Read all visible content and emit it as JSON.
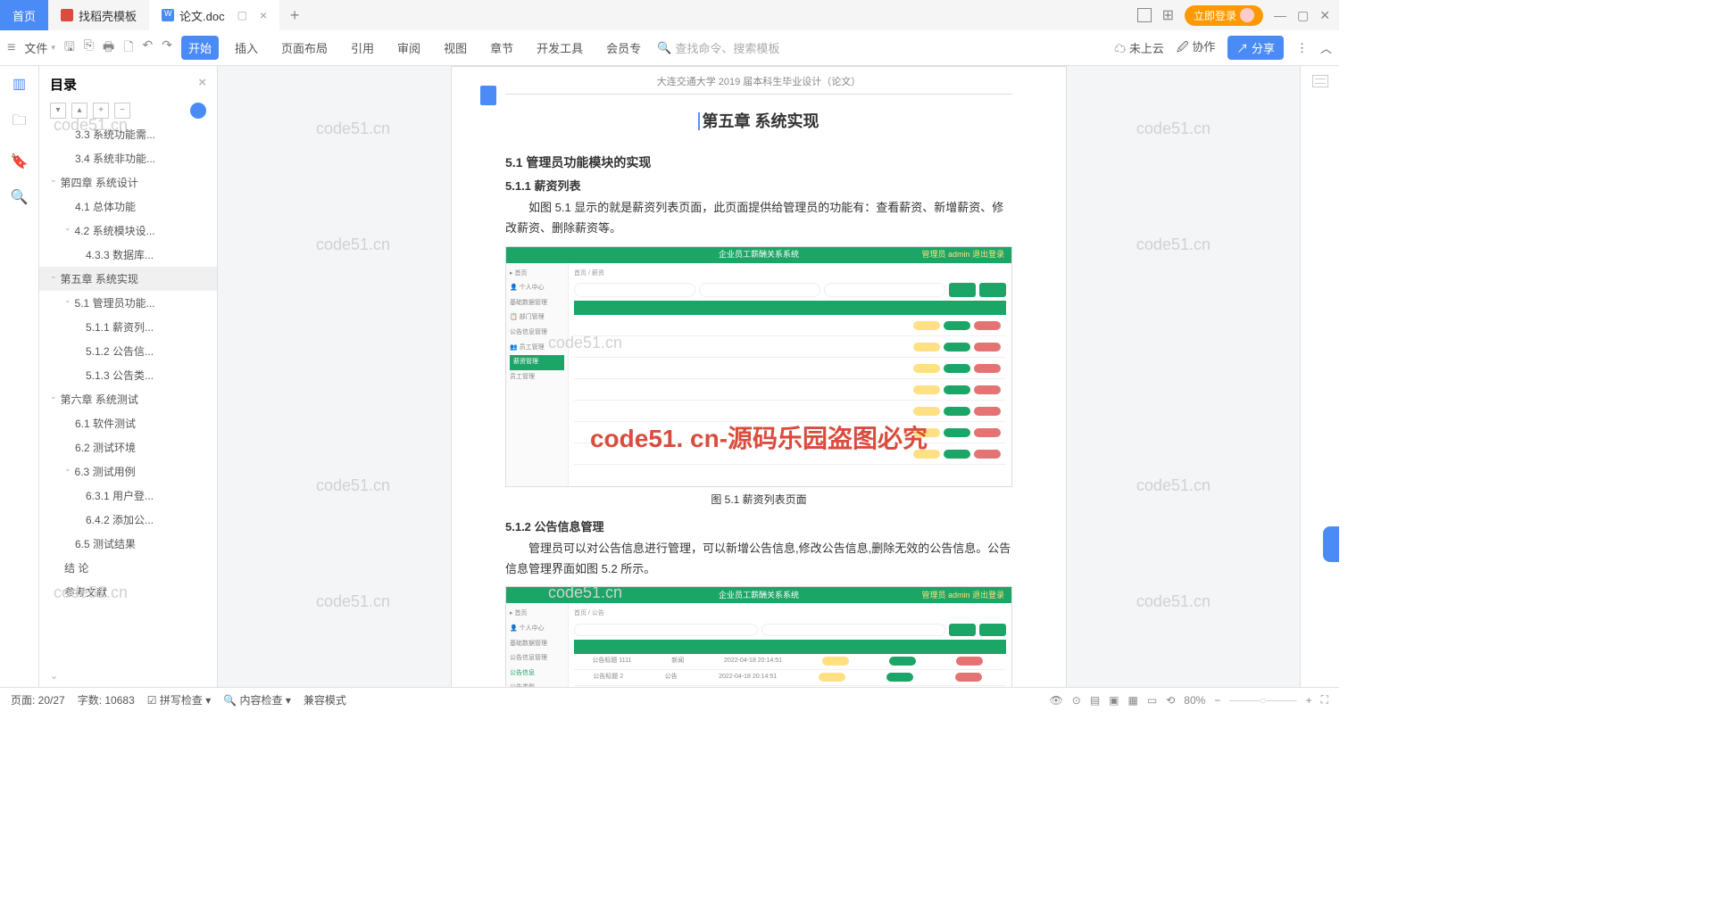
{
  "tabs": {
    "home": "首页",
    "t1": "找稻壳模板",
    "t2": "论文.doc"
  },
  "login": "立即登录",
  "ribbon": {
    "file": "文件",
    "tabs": [
      "开始",
      "插入",
      "页面布局",
      "引用",
      "审阅",
      "视图",
      "章节",
      "开发工具",
      "会员专"
    ],
    "search_ph": "查找命令、搜索模板",
    "cloud": "未上云",
    "collab": "协作",
    "share": "分享"
  },
  "outline": {
    "title": "目录",
    "items": [
      {
        "t": "3.3 系统功能需...",
        "lv": 2
      },
      {
        "t": "3.4 系统非功能...",
        "lv": 2
      },
      {
        "t": "第四章  系统设计",
        "lv": 0,
        "exp": "v"
      },
      {
        "t": "4.1 总体功能",
        "lv": 2
      },
      {
        "t": "4.2 系统模块设...",
        "lv": 1,
        "exp": "v"
      },
      {
        "t": "4.3.3 数据库...",
        "lv": 3
      },
      {
        "t": "第五章  系统实现",
        "lv": 0,
        "exp": "v",
        "active": true
      },
      {
        "t": "5.1 管理员功能...",
        "lv": 1,
        "exp": "v"
      },
      {
        "t": "5.1.1 薪资列...",
        "lv": 3
      },
      {
        "t": "5.1.2 公告信...",
        "lv": 3
      },
      {
        "t": "5.1.3 公告类...",
        "lv": 3
      },
      {
        "t": "第六章  系统测试",
        "lv": 0,
        "exp": "v"
      },
      {
        "t": "6.1 软件测试",
        "lv": 2
      },
      {
        "t": "6.2 测试环境",
        "lv": 2
      },
      {
        "t": "6.3 测试用例",
        "lv": 1,
        "exp": "v"
      },
      {
        "t": "6.3.1 用户登...",
        "lv": 3
      },
      {
        "t": "6.4.2 添加公...",
        "lv": 3
      },
      {
        "t": "6.5 测试结果",
        "lv": 2
      },
      {
        "t": "结  论",
        "lv": 1
      },
      {
        "t": "参考文献",
        "lv": 1
      }
    ]
  },
  "doc": {
    "hdr": "大连交通大学 2019 届本科生毕业设计（论文）",
    "chapter": "第五章  系统实现",
    "h2_1": "5.1  管理员功能模块的实现",
    "h3_1": "5.1.1  薪资列表",
    "p1": "如图 5.1 显示的就是薪资列表页面，此页面提供给管理员的功能有：查看薪资、新增薪资、修改薪资、删除薪资等。",
    "sysname": "企业员工薪酬关系系统",
    "admin": "管理员 admin    退出登录",
    "cap1": "图 5.1  薪资列表页面",
    "h3_2": "5.1.2  公告信息管理",
    "p2": "管理员可以对公告信息进行管理，可以新增公告信息,修改公告信息,删除无效的公告信息。公告信息管理界面如图 5.2 所示。"
  },
  "wm": "code51.cn",
  "wm_red": "code51. cn-源码乐园盗图必究",
  "status": {
    "page": "页面: 20/27",
    "words": "字数: 10683",
    "spell": "拼写检查",
    "content": "内容检查",
    "compat": "兼容模式",
    "zoom": "80%"
  }
}
